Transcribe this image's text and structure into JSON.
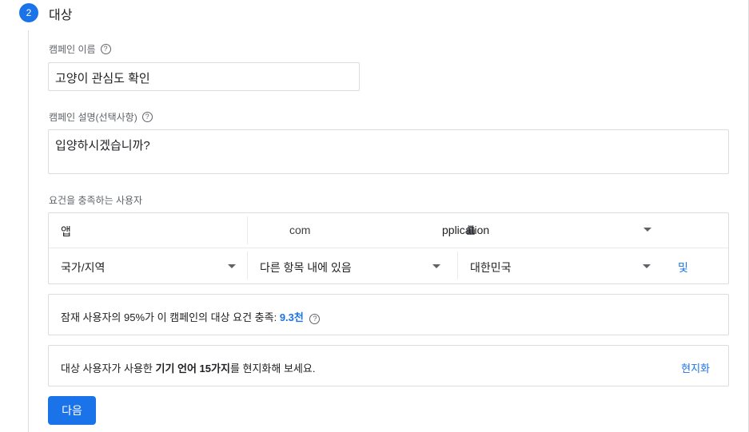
{
  "step": {
    "number": "2",
    "title": "대상"
  },
  "campaign_name": {
    "label": "캠페인 이름",
    "value": "고양이 관심도 확인"
  },
  "campaign_desc": {
    "label": "캠페인 설명(선택사항)",
    "value": "입양하시겠습니까?"
  },
  "audience": {
    "label": "요건을 충족하는 사용자",
    "row1": {
      "type": "앱",
      "app_prefix": "com",
      "app_suffix": "pplication"
    },
    "row2": {
      "field": "국가/지역",
      "operator": "다른 항목 내에 있음",
      "value": "대한민국",
      "and_label": "및"
    }
  },
  "estimate": {
    "prefix": "잠재 사용자의 95%가 이 캠페인의 대상 요건 충족: ",
    "count": "9.3천"
  },
  "localize": {
    "text_before": "대상 사용자가 사용한 ",
    "text_bold": "기기 언어 15가지",
    "text_after": "를 현지화해 보세요.",
    "action": "현지화"
  },
  "next_button": "다음",
  "help_glyph": "?"
}
